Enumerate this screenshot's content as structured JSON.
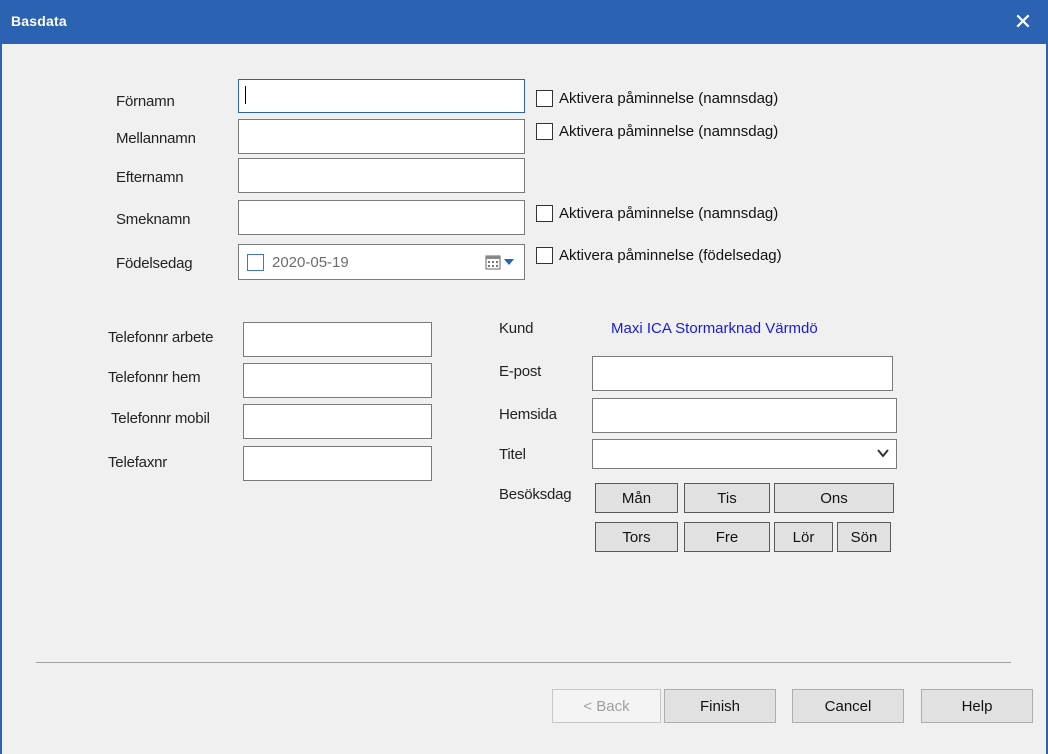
{
  "window": {
    "title": "Basdata",
    "close_glyph": "✕"
  },
  "form": {
    "fornamn_label": "Förnamn",
    "mellannamn_label": "Mellannamn",
    "efternamn_label": "Efternamn",
    "smeknamn_label": "Smeknamn",
    "fodelsedag_label": "Födelsedag",
    "fornamn_value": "",
    "mellannamn_value": "",
    "efternamn_value": "",
    "smeknamn_value": "",
    "fodelsedag_value": "2020-05-19"
  },
  "reminders": {
    "namnsdag_label": "Aktivera påminnelse (namnsdag)",
    "fodelsedag_label": "Aktivera påminnelse (födelsedag)"
  },
  "phones": {
    "arbete_label": "Telefonnr arbete",
    "hem_label": "Telefonnr hem",
    "mobil_label": "Telefonnr mobil",
    "fax_label": "Telefaxnr"
  },
  "contact": {
    "kund_label": "Kund",
    "kund_value": "Maxi ICA Stormarknad Värmdö",
    "epost_label": "E-post",
    "hemsida_label": "Hemsida",
    "titel_label": "Titel",
    "besoksdag_label": "Besöksdag"
  },
  "days": [
    "Mån",
    "Tis",
    "Ons",
    "Tors",
    "Fre",
    "Lör",
    "Sön"
  ],
  "buttons": {
    "back": "< Back",
    "finish": "Finish",
    "cancel": "Cancel",
    "help": "Help"
  },
  "colors": {
    "titlebar": "#2b62b2",
    "link": "#1a1adb"
  }
}
